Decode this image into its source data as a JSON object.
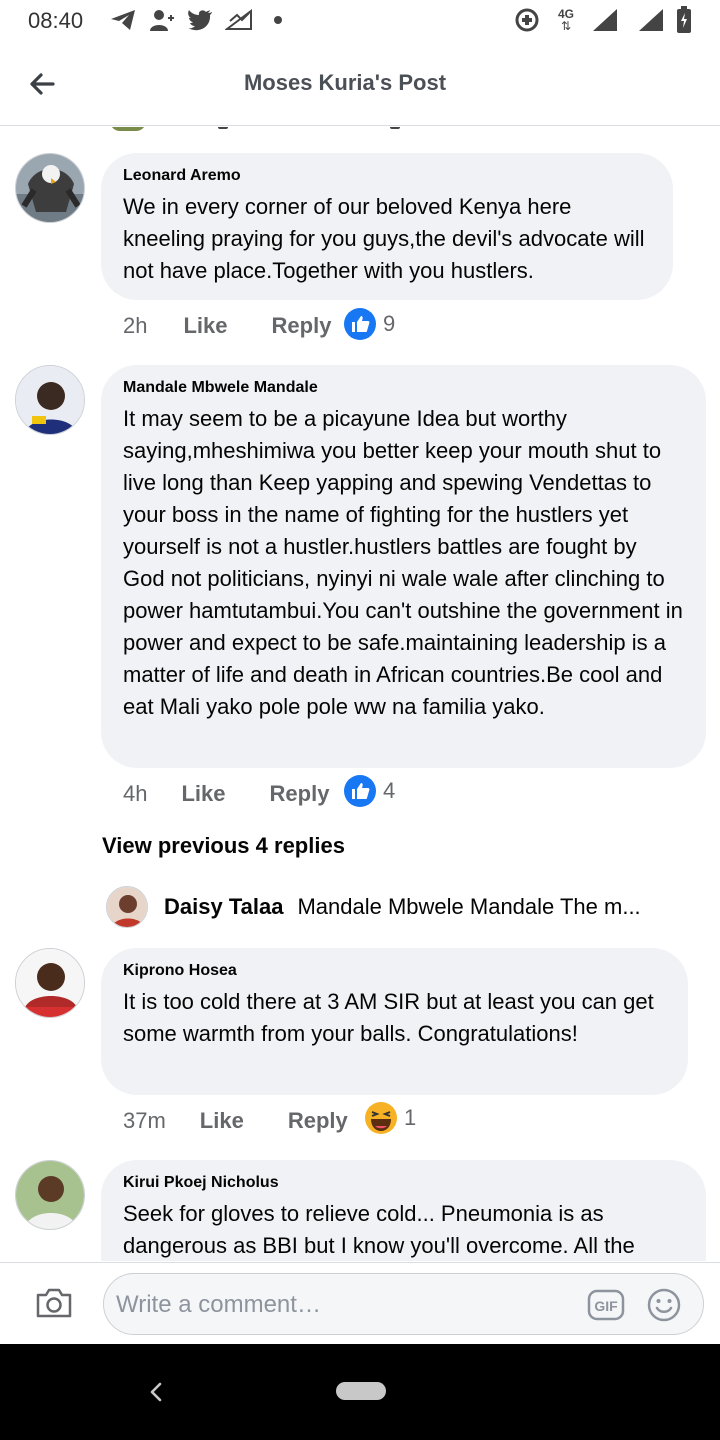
{
  "status_bar": {
    "time": "08:40",
    "network_label": "4G",
    "icons": [
      "telegram-icon",
      "add-friend-icon",
      "twitter-icon",
      "missed-signal-icon",
      "dot-icon",
      "data-saver-icon",
      "network-4g-icon",
      "signal-icon",
      "signal-icon-2",
      "battery-icon"
    ]
  },
  "header": {
    "title": "Moses Kuria's Post",
    "back_icon": "back-arrow-icon"
  },
  "comments": [
    {
      "author": "Leonard Aremo",
      "text": "We in every corner of our beloved Kenya here kneeling praying for you guys,the devil's advocate will not have place.Together with you hustlers.",
      "time": "2h",
      "like_label": "Like",
      "reply_label": "Reply",
      "reaction": "like",
      "reaction_count": "9",
      "avatar_color": "#5a6b7a"
    },
    {
      "author": "Mandale Mbwele Mandale",
      "text": "It may seem to be a picayune Idea but worthy saying,mheshimiwa you better keep your mouth shut to live long than Keep yapping and spewing Vendettas to your boss in the name of fighting for the hustlers yet yourself is not a hustler.hustlers battles are  fought by God not politicians, nyinyi ni wale wale after clinching to power hamtutambui.You can't outshine the government in power and expect to be safe.maintaining leadership is a matter of life and death in African countries.Be cool and eat Mali yako pole pole ww na familia yako.",
      "time": "4h",
      "like_label": "Like",
      "reply_label": "Reply",
      "reaction": "like",
      "reaction_count": "4",
      "avatar_color": "#2b3a8a"
    },
    {
      "author": "Kiprono Hosea",
      "text": "It is too cold there at 3 AM SIR but at least you can get some warmth from your balls. Congratulations!",
      "time": "37m",
      "like_label": "Like",
      "reply_label": "Reply",
      "reaction": "haha",
      "reaction_count": "1",
      "avatar_color": "#c0392b"
    },
    {
      "author": "Kirui Pkoej Nicholus",
      "text": "Seek for gloves to relieve cold... Pneumonia is as dangerous as BBI but I know you'll overcome. All the",
      "avatar_color": "#7fa36b"
    }
  ],
  "replies_section": {
    "view_previous": "View previous 4 replies",
    "reply_author": "Daisy Talaa",
    "reply_text": "Mandale Mbwele Mandale The m..."
  },
  "composer": {
    "placeholder": "Write a comment…",
    "gif_label": "GIF"
  },
  "colors": {
    "bubble": "#f0f2f5",
    "like_blue": "#1877f2",
    "meta_grey": "#65676b",
    "haha_yellow": "#f7b125"
  }
}
